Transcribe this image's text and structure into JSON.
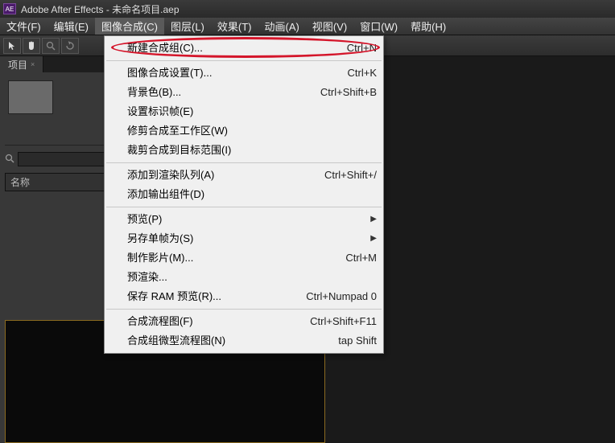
{
  "title": "Adobe After Effects - 未命名项目.aep",
  "app_icon_text": "AE",
  "menubar": [
    "文件(F)",
    "编辑(E)",
    "图像合成(C)",
    "图层(L)",
    "效果(T)",
    "动画(A)",
    "视图(V)",
    "窗口(W)",
    "帮助(H)"
  ],
  "active_menu_index": 2,
  "panel": {
    "tab_label": "项目",
    "tab_close": "×",
    "search_placeholder": "",
    "column_header": "名称"
  },
  "dropdown": {
    "groups": [
      [
        {
          "label": "新建合成组(C)...",
          "shortcut": "Ctrl+N",
          "submenu": false
        }
      ],
      [
        {
          "label": "图像合成设置(T)...",
          "shortcut": "Ctrl+K",
          "submenu": false
        },
        {
          "label": "背景色(B)...",
          "shortcut": "Ctrl+Shift+B",
          "submenu": false
        },
        {
          "label": "设置标识帧(E)",
          "shortcut": "",
          "submenu": false
        },
        {
          "label": "修剪合成至工作区(W)",
          "shortcut": "",
          "submenu": false
        },
        {
          "label": "裁剪合成到目标范围(I)",
          "shortcut": "",
          "submenu": false
        }
      ],
      [
        {
          "label": "添加到渲染队列(A)",
          "shortcut": "Ctrl+Shift+/",
          "submenu": false
        },
        {
          "label": "添加输出组件(D)",
          "shortcut": "",
          "submenu": false
        }
      ],
      [
        {
          "label": "预览(P)",
          "shortcut": "",
          "submenu": true
        },
        {
          "label": "另存单帧为(S)",
          "shortcut": "",
          "submenu": true
        },
        {
          "label": "制作影片(M)...",
          "shortcut": "Ctrl+M",
          "submenu": false
        },
        {
          "label": "预渲染...",
          "shortcut": "",
          "submenu": false
        },
        {
          "label": "保存 RAM 预览(R)...",
          "shortcut": "Ctrl+Numpad 0",
          "submenu": false
        }
      ],
      [
        {
          "label": "合成流程图(F)",
          "shortcut": "Ctrl+Shift+F11",
          "submenu": false
        },
        {
          "label": "合成组微型流程图(N)",
          "shortcut": "tap Shift",
          "submenu": false
        }
      ]
    ]
  }
}
